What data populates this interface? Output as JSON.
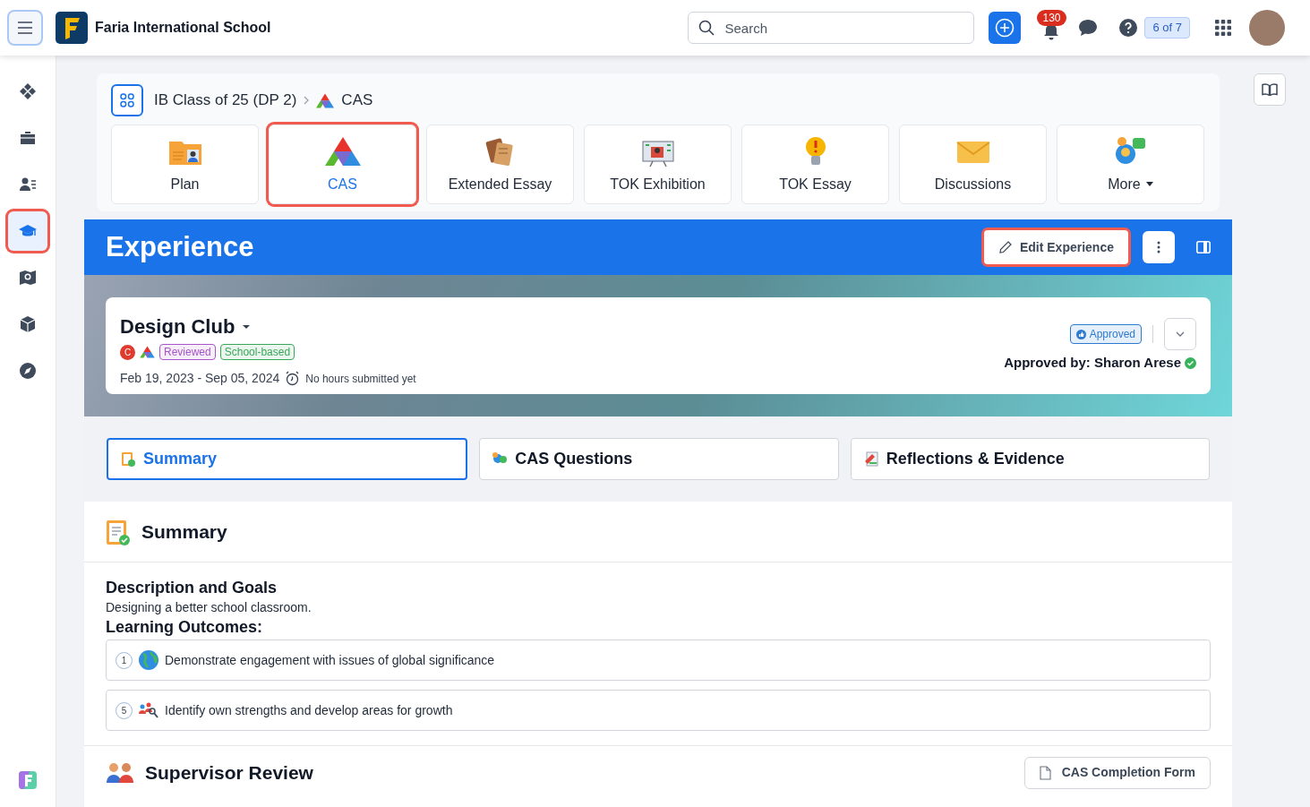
{
  "header": {
    "school_name": "Faria International School",
    "search": {
      "placeholder": "Search"
    },
    "notification_count": "130",
    "pager": "6 of 7"
  },
  "sidebar": {
    "items": [
      {
        "kind": "modules",
        "selected": false
      },
      {
        "kind": "briefcase",
        "selected": false
      },
      {
        "kind": "people",
        "selected": false
      },
      {
        "kind": "graduation",
        "selected": true
      },
      {
        "kind": "map",
        "selected": false
      },
      {
        "kind": "box",
        "selected": false
      },
      {
        "kind": "compass",
        "selected": false
      }
    ]
  },
  "breadcrumb": [
    "IB Class of 25 (DP 2)",
    "CAS"
  ],
  "nav_tiles": [
    {
      "label": "Plan",
      "kind": "plan",
      "selected": false
    },
    {
      "label": "CAS",
      "kind": "cas",
      "selected": true
    },
    {
      "label": "Extended Essay",
      "kind": "essay",
      "selected": false
    },
    {
      "label": "TOK Exhibition",
      "kind": "exhibition",
      "selected": false
    },
    {
      "label": "TOK Essay",
      "kind": "bulb",
      "selected": false
    },
    {
      "label": "Discussions",
      "kind": "envelope",
      "selected": false
    },
    {
      "label": "More",
      "kind": "more",
      "selected": false
    }
  ],
  "experience": {
    "heading": "Experience",
    "edit_button": "Edit Experience"
  },
  "activity": {
    "title": "Design Club",
    "strand_letter": "C",
    "badges": [
      {
        "label": "Reviewed",
        "color": "#a855c9"
      },
      {
        "label": "School-based",
        "color": "#3aa65a"
      }
    ],
    "dates": "Feb 19, 2023 - Sep 05, 2024",
    "hours": "No hours submitted yet",
    "status": "Approved",
    "approved_by": "Approved by: Sharon Arese"
  },
  "tabs": [
    {
      "label": "Summary",
      "kind": "summary",
      "selected": true
    },
    {
      "label": "CAS Questions",
      "kind": "questions",
      "selected": false
    },
    {
      "label": "Reflections & Evidence",
      "kind": "reflections",
      "selected": false
    }
  ],
  "summary": {
    "heading": "Summary",
    "description_heading": "Description and Goals",
    "description": "Designing a better school classroom.",
    "outcomes_heading": "Learning Outcomes:",
    "outcomes": [
      {
        "number": "1",
        "kind": "globe",
        "text": "Demonstrate engagement with issues of global significance"
      },
      {
        "number": "5",
        "kind": "people",
        "text": "Identify own strengths and develop areas for growth"
      }
    ]
  },
  "supervisor_review": {
    "heading": "Supervisor Review",
    "form_button": "CAS Completion Form"
  }
}
